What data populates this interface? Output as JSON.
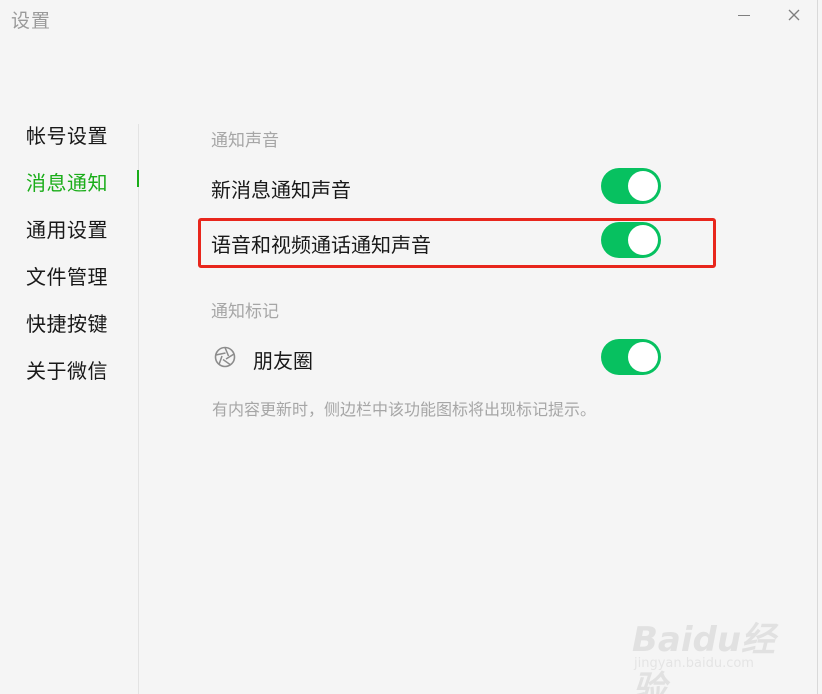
{
  "window": {
    "title": "设置",
    "minimize_icon": "minimize-icon",
    "close_icon": "close-icon"
  },
  "sidebar": {
    "items": [
      {
        "label": "帐号设置",
        "active": false
      },
      {
        "label": "消息通知",
        "active": true
      },
      {
        "label": "通用设置",
        "active": false
      },
      {
        "label": "文件管理",
        "active": false
      },
      {
        "label": "快捷按键",
        "active": false
      },
      {
        "label": "关于微信",
        "active": false
      }
    ]
  },
  "main": {
    "sound_section": {
      "title": "通知声音",
      "rows": [
        {
          "label": "新消息通知声音",
          "enabled": true
        },
        {
          "label": "语音和视频通话通知声音",
          "enabled": true
        }
      ]
    },
    "mark_section": {
      "title": "通知标记",
      "rows": [
        {
          "label": "朋友圈",
          "icon": "moments-aperture-icon",
          "enabled": true
        }
      ],
      "hint": "有内容更新时，侧边栏中该功能图标将出现标记提示。"
    }
  },
  "colors": {
    "accent": "#1aad19",
    "toggle_on": "#07c160",
    "highlight": "#e8261c",
    "secondary_text": "#a6a6a6"
  },
  "watermark": {
    "logo": "Baidu经验",
    "url": "jingyan.baidu.com"
  }
}
